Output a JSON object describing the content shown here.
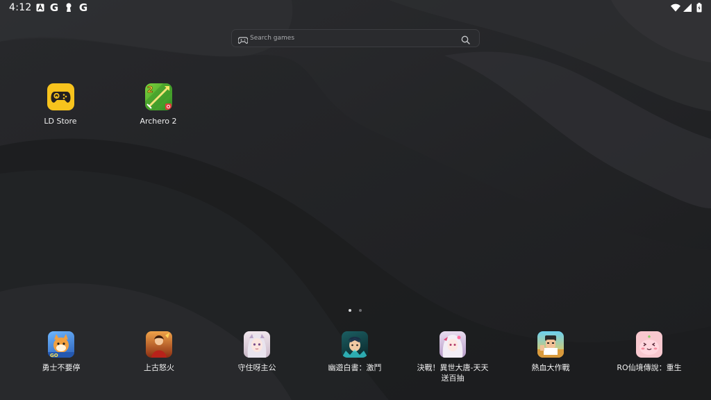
{
  "status_bar": {
    "time": "4:12",
    "left_icons": [
      "notification-a-icon",
      "google-g-icon",
      "keyhole-icon",
      "google-g-icon"
    ],
    "google_letter": "G",
    "right_icons": [
      "wifi-icon",
      "cell-signal-icon",
      "battery-icon"
    ]
  },
  "search": {
    "placeholder": "Search games"
  },
  "desktop_apps": [
    {
      "label": "LD Store",
      "icon": "ld-store-icon"
    },
    {
      "label": "Archero 2",
      "icon": "archero-2-icon"
    }
  ],
  "page_indicator": {
    "pages": 2,
    "current": 1
  },
  "dock_apps": [
    {
      "label": "勇士不要停",
      "icon": "game-icon-warrior"
    },
    {
      "label": "上古怒火",
      "icon": "game-icon-ancient-fury"
    },
    {
      "label": "守住呀主公",
      "icon": "game-icon-guard-lord"
    },
    {
      "label": "幽遊白書：激鬥",
      "icon": "game-icon-yuyu-hakusho"
    },
    {
      "label": "決戰！異世大唐-天天送百抽",
      "icon": "game-icon-otherworld-tang"
    },
    {
      "label": "熱血大作戰",
      "icon": "game-icon-hot-blood"
    },
    {
      "label": "RO仙境傳說：重生",
      "icon": "game-icon-ragnarok"
    }
  ],
  "colors": {
    "ld_store_yellow": "#f7c31d",
    "archero_green": "#4ca52f",
    "text": "#ffffff"
  }
}
